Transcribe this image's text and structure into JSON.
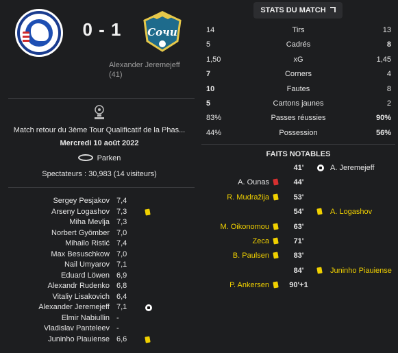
{
  "match": {
    "home_team": "F.C. København",
    "away_team": "Sochi",
    "score": "0 - 1",
    "scorer_name": "Alexander Jeremejeff",
    "scorer_minute": "(41)"
  },
  "info": {
    "competition": "Match retour du 3ème Tour Qualificatif de la Phas...",
    "date": "Mercredi 10 août 2022",
    "venue": "Parken",
    "attendance": "Spectateurs : 30,983 (14 visiteurs)"
  },
  "lineup": [
    {
      "name": "Sergey Pesjakov",
      "rating": "7,4",
      "event": ""
    },
    {
      "name": "Arseny Logashov",
      "rating": "7,3",
      "event": "yellow-card"
    },
    {
      "name": "Miha Mevlja",
      "rating": "7,3",
      "event": ""
    },
    {
      "name": "Norbert Gyömber",
      "rating": "7,0",
      "event": ""
    },
    {
      "name": "Mihailo Ristić",
      "rating": "7,4",
      "event": ""
    },
    {
      "name": "Max Besuschkow",
      "rating": "7,0",
      "event": ""
    },
    {
      "name": "Nail Umyarov",
      "rating": "7,1",
      "event": ""
    },
    {
      "name": "Eduard Löwen",
      "rating": "6,9",
      "event": ""
    },
    {
      "name": "Alexandr Rudenko",
      "rating": "6,8",
      "event": ""
    },
    {
      "name": "Vitaliy Lisakovich",
      "rating": "6,4",
      "event": ""
    },
    {
      "name": "Alexander Jeremejeff",
      "rating": "7,1",
      "event": "goal"
    },
    {
      "name": "Elmir Nabiullin",
      "rating": "-",
      "event": ""
    },
    {
      "name": "Vladislav Panteleev",
      "rating": "-",
      "event": ""
    },
    {
      "name": "Juninho Piauiense",
      "rating": "6,6",
      "event": "yellow-card"
    }
  ],
  "stats_header": "STATS DU MATCH",
  "stats": [
    {
      "home": "14",
      "label": "Tirs",
      "away": "13",
      "bold_side": "none"
    },
    {
      "home": "5",
      "label": "Cadrés",
      "away": "8",
      "bold_side": "away"
    },
    {
      "home": "1,50",
      "label": "xG",
      "away": "1,45",
      "bold_side": "none"
    },
    {
      "home": "7",
      "label": "Corners",
      "away": "4",
      "bold_side": "home"
    },
    {
      "home": "10",
      "label": "Fautes",
      "away": "8",
      "bold_side": "home"
    },
    {
      "home": "5",
      "label": "Cartons jaunes",
      "away": "2",
      "bold_side": "home"
    },
    {
      "home": "83%",
      "label": "Passes réussies",
      "away": "90%",
      "bold_side": "away"
    },
    {
      "home": "44%",
      "label": "Possession",
      "away": "56%",
      "bold_side": "away"
    }
  ],
  "faits_title": "FAITS NOTABLES",
  "events": [
    {
      "minute": "41'",
      "home_name": "",
      "home_icon": "",
      "away_name": "A. Jeremejeff",
      "away_icon": "goal"
    },
    {
      "minute": "44'",
      "home_name": "A. Ounas",
      "home_icon": "injury",
      "away_name": "",
      "away_icon": ""
    },
    {
      "minute": "53'",
      "home_name": "R. Mudražija",
      "home_icon": "yellow-card",
      "away_name": "",
      "away_icon": ""
    },
    {
      "minute": "54'",
      "home_name": "",
      "home_icon": "",
      "away_name": "A. Logashov",
      "away_icon": "yellow-card"
    },
    {
      "minute": "63'",
      "home_name": "M. Oikonomou",
      "home_icon": "yellow-card",
      "away_name": "",
      "away_icon": ""
    },
    {
      "minute": "71'",
      "home_name": "Zeca",
      "home_icon": "yellow-card",
      "away_name": "",
      "away_icon": ""
    },
    {
      "minute": "83'",
      "home_name": "B. Paulsen",
      "home_icon": "yellow-card",
      "away_name": "",
      "away_icon": ""
    },
    {
      "minute": "84'",
      "home_name": "",
      "home_icon": "",
      "away_name": "Juninho Piauiense",
      "away_icon": "yellow-card"
    },
    {
      "minute": "90'+1",
      "home_name": "P. Ankersen",
      "home_icon": "yellow-card",
      "away_name": "",
      "away_icon": ""
    }
  ],
  "colors": {
    "background": "#1d1e20",
    "yellow_card": "#f0d000",
    "highlight_name": "#f0d000",
    "red_card": "#d63030"
  }
}
